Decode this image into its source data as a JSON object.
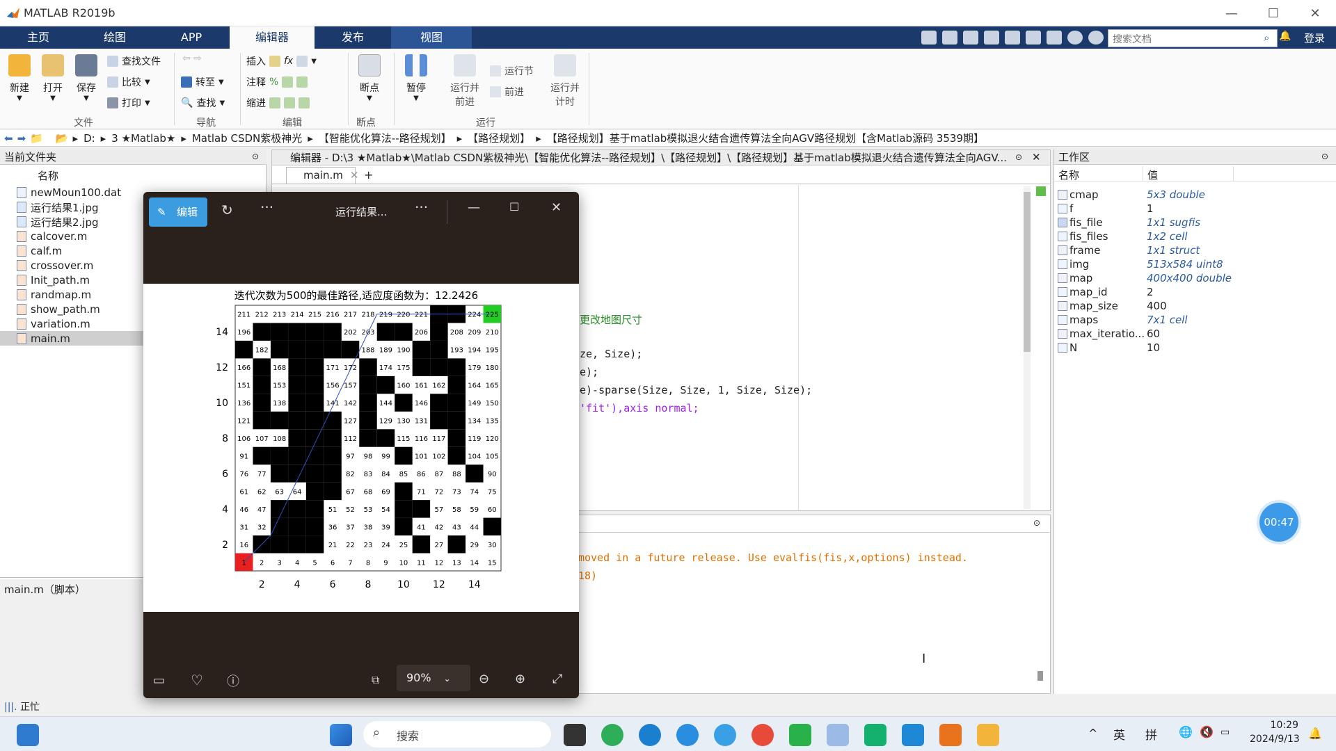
{
  "window": {
    "title": "MATLAB R2019b"
  },
  "tabs": [
    "主页",
    "绘图",
    "APP",
    "编辑器",
    "发布",
    "视图"
  ],
  "search_docs": {
    "placeholder": "搜索文档"
  },
  "login": "登录",
  "ribbon": {
    "file": {
      "new": "新建",
      "open": "打开",
      "save": "保存",
      "find_files": "查找文件",
      "compare": "比较",
      "print": "打印",
      "label": "文件"
    },
    "nav": {
      "goto": "转至",
      "find": "查找",
      "label": "导航"
    },
    "edit": {
      "insert": "插入",
      "comment": "注释",
      "indent": "缩进",
      "label": "编辑"
    },
    "breakpoints": {
      "btn": "断点",
      "label": "断点"
    },
    "run": {
      "pause": "暂停",
      "run_advance": "运行并\n前进",
      "run_section": "运行节",
      "advance": "前进",
      "run_time": "运行并\n计时",
      "label": "运行"
    }
  },
  "address": [
    "D:",
    "3 ★Matlab★",
    "Matlab CSDN紫极神光",
    "【智能优化算法--路径规划】",
    "【路径规划】",
    "【路径规划】基于matlab模拟退火结合遗传算法全向AGV路径规划【含Matlab源码 3539期】"
  ],
  "current_folder": {
    "title": "当前文件夹",
    "col_name": "名称",
    "files": [
      "newMoun100.dat",
      "运行结果1.jpg",
      "运行结果2.jpg",
      "calcover.m",
      "calf.m",
      "crossover.m",
      "Init_path.m",
      "randmap.m",
      "show_path.m",
      "variation.m",
      "main.m"
    ],
    "selected": "main.m",
    "detail": "main.m（脚本）"
  },
  "editor": {
    "title": "编辑器 - D:\\3 ★Matlab★\\Matlab CSDN紫极神光\\【智能优化算法--路径规划】\\【路径规划】\\【路径规划】基于matlab模拟退火结合遗传算法全向AGV...",
    "tab": "main.m",
    "lines": [
      "更改地图尺寸",
      "ze, Size);",
      "e);",
      "e)-sparse(Size, Size, 1, Size, Size);",
      "'fit'),axis normal;"
    ]
  },
  "console": {
    "lines": [
      "moved in a future release. Use evalfis(fis,x,options) instead.",
      "18)"
    ]
  },
  "workspace": {
    "title": "工作区",
    "col_name": "名称",
    "col_value": "值",
    "rows": [
      [
        "cmap",
        "5x3 double"
      ],
      [
        "f",
        "1"
      ],
      [
        "fis_file",
        "1x1 sugfis"
      ],
      [
        "fis_files",
        "1x2 cell"
      ],
      [
        "frame",
        "1x1 struct"
      ],
      [
        "img",
        "513x584 uint8"
      ],
      [
        "map",
        "400x400 double"
      ],
      [
        "map_id",
        "2"
      ],
      [
        "map_size",
        "400"
      ],
      [
        "maps",
        "7x1 cell"
      ],
      [
        "max_iteratio...",
        "60"
      ],
      [
        "N",
        "10"
      ]
    ]
  },
  "viewer": {
    "edit": "编辑",
    "title": "运行结果...",
    "zoom": "90%"
  },
  "plot": {
    "title": "迭代次数为500的最佳路径,适应度函数为：12.2426",
    "x_ticks": [
      "2",
      "4",
      "6",
      "8",
      "10",
      "12",
      "14"
    ],
    "y_ticks": [
      "14",
      "12",
      "10",
      "8",
      "6",
      "4",
      "2"
    ]
  },
  "timer": "00:47",
  "taskbar": {
    "search": "搜索",
    "ime1": "英",
    "ime2": "拼",
    "time": "10:29",
    "date": "2024/9/13"
  },
  "status": "正忙"
}
